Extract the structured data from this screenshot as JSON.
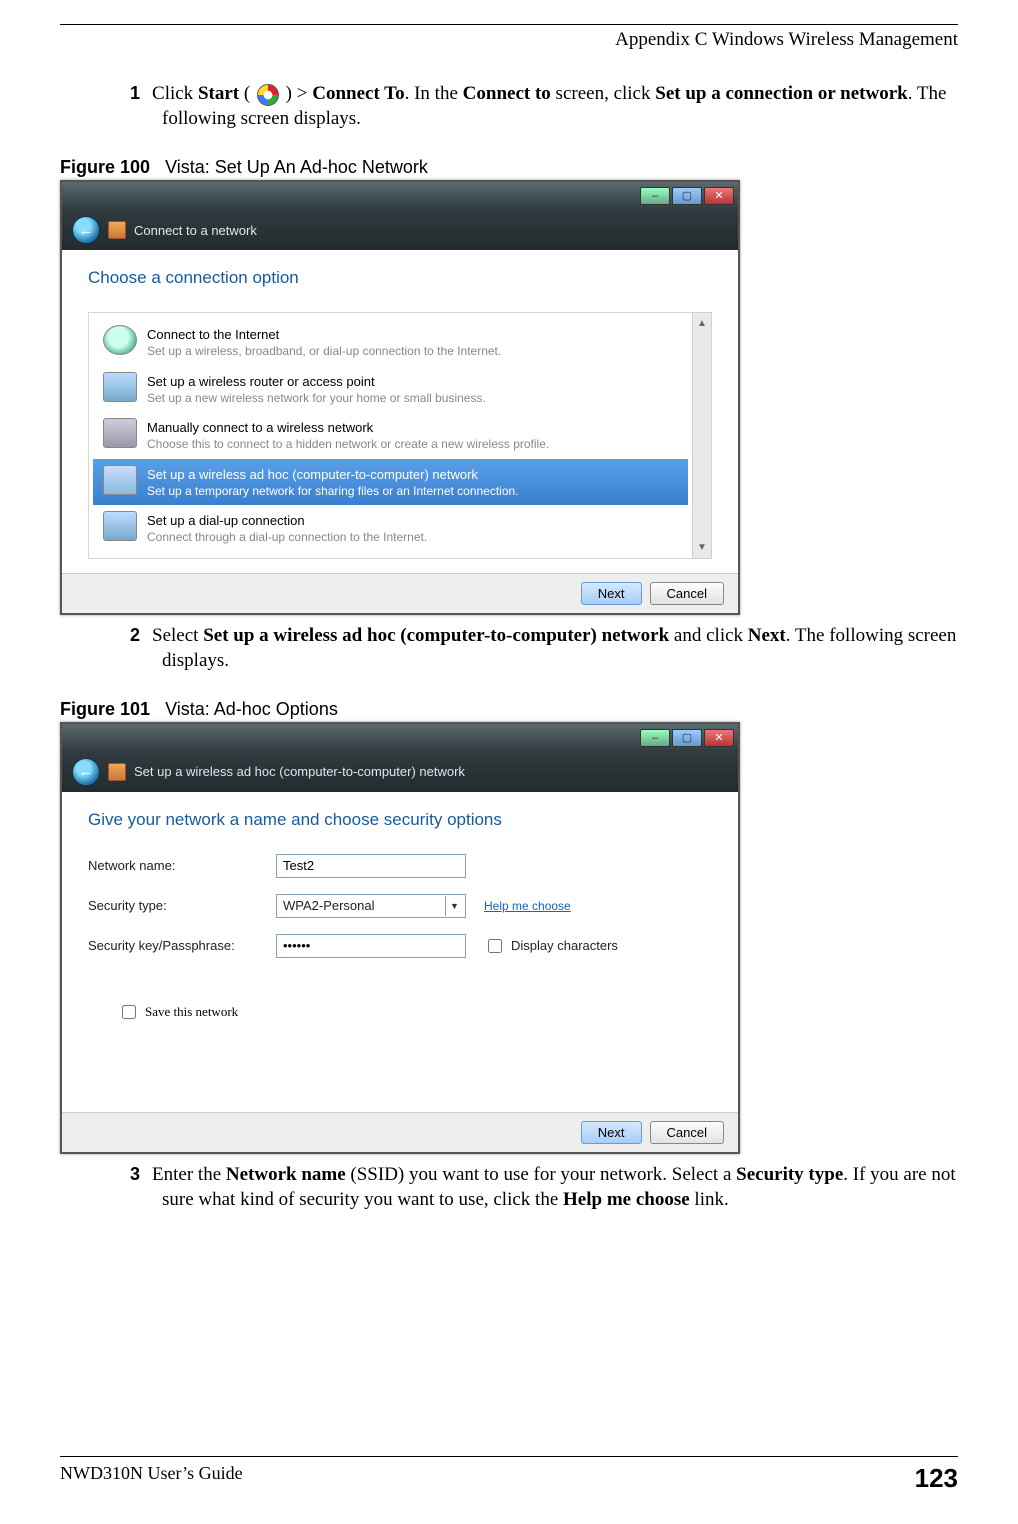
{
  "header": {
    "title": "Appendix C Windows Wireless Management"
  },
  "step1": {
    "num": "1",
    "t1": "Click ",
    "b1": "Start",
    "t2": " ( ",
    "t3": " ) > ",
    "b2": "Connect To",
    "t4": ". In the ",
    "b3": "Connect to",
    "t5": " screen, click ",
    "b4": "Set up a connection or network",
    "t6": ". The following screen displays."
  },
  "fig100": {
    "label": "Figure 100",
    "title": "Vista: Set Up An Ad-hoc Network",
    "chrome_title": "Connect to a network",
    "heading": "Choose a connection option",
    "opts": [
      {
        "title": "Connect to the Internet",
        "desc": "Set up a wireless, broadband, or dial-up connection to the Internet."
      },
      {
        "title": "Set up a wireless router or access point",
        "desc": "Set up a new wireless network for your home or small business."
      },
      {
        "title": "Manually connect to a wireless network",
        "desc": "Choose this to connect to a hidden network or create a new wireless profile."
      },
      {
        "title": "Set up a wireless ad hoc (computer-to-computer) network",
        "desc": "Set up a temporary network for sharing files or an Internet connection."
      },
      {
        "title": "Set up a dial-up connection",
        "desc": "Connect through a dial-up connection to the Internet."
      }
    ],
    "next": "Next",
    "cancel": "Cancel"
  },
  "step2": {
    "num": "2",
    "t1": "Select ",
    "b1": "Set up a wireless ad hoc (computer-to-computer) network",
    "t2": " and click ",
    "b2": "Next",
    "t3": ". The following screen displays."
  },
  "fig101": {
    "label": "Figure 101",
    "title": "Vista: Ad-hoc Options",
    "chrome_title": "Set up a wireless ad hoc (computer-to-computer) network",
    "heading": "Give your network a name and choose security options",
    "labels": {
      "name": "Network name:",
      "sectype": "Security type:",
      "key": "Security key/Passphrase:",
      "display": "Display characters",
      "save": "Save this network",
      "help": "Help me choose"
    },
    "values": {
      "name": "Test2",
      "sectype": "WPA2-Personal",
      "key": "••••••"
    },
    "next": "Next",
    "cancel": "Cancel"
  },
  "step3": {
    "num": "3",
    "t1": "Enter the ",
    "b1": "Network name",
    "t2": " (SSID) you want to use for your network. Select a ",
    "b2": "Security type",
    "t3": ". If you are not sure what kind of security you want to use, click the ",
    "b3": "Help me choose",
    "t4": " link."
  },
  "footer": {
    "guide": "NWD310N User’s Guide",
    "page": "123"
  }
}
